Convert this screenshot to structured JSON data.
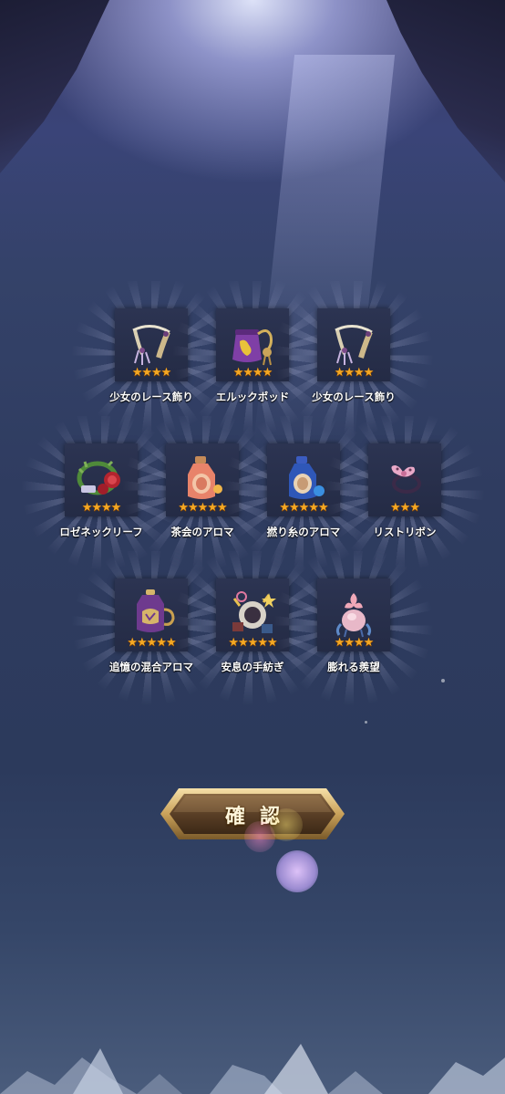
{
  "colors": {
    "star": "#f4a824",
    "item_label": "#ffffff",
    "button_gold": "#c9a15a"
  },
  "rewards": [
    {
      "name": "少女のレース飾り",
      "rarity": 4,
      "icon": "lace-ornament-icon"
    },
    {
      "name": "エルックポッド",
      "rarity": 4,
      "icon": "purple-pouch-icon"
    },
    {
      "name": "少女のレース飾り",
      "rarity": 4,
      "icon": "lace-ornament-icon"
    },
    {
      "name": "ロゼネックリーフ",
      "rarity": 4,
      "icon": "rose-wreath-icon"
    },
    {
      "name": "茶会のアロマ",
      "rarity": 5,
      "icon": "pink-aroma-bottle-icon"
    },
    {
      "name": "撚り糸のアロマ",
      "rarity": 5,
      "icon": "blue-aroma-bottle-icon"
    },
    {
      "name": "リストリボン",
      "rarity": 3,
      "icon": "wrist-ribbon-icon"
    },
    {
      "name": "追憶の混合アロマ",
      "rarity": 5,
      "icon": "purple-aroma-lamp-icon"
    },
    {
      "name": "安息の手紡ぎ",
      "rarity": 5,
      "icon": "spinning-charm-icon"
    },
    {
      "name": "膨れる羨望",
      "rarity": 4,
      "icon": "pink-flower-bulb-icon"
    }
  ],
  "confirm_button": {
    "label": "確認"
  }
}
